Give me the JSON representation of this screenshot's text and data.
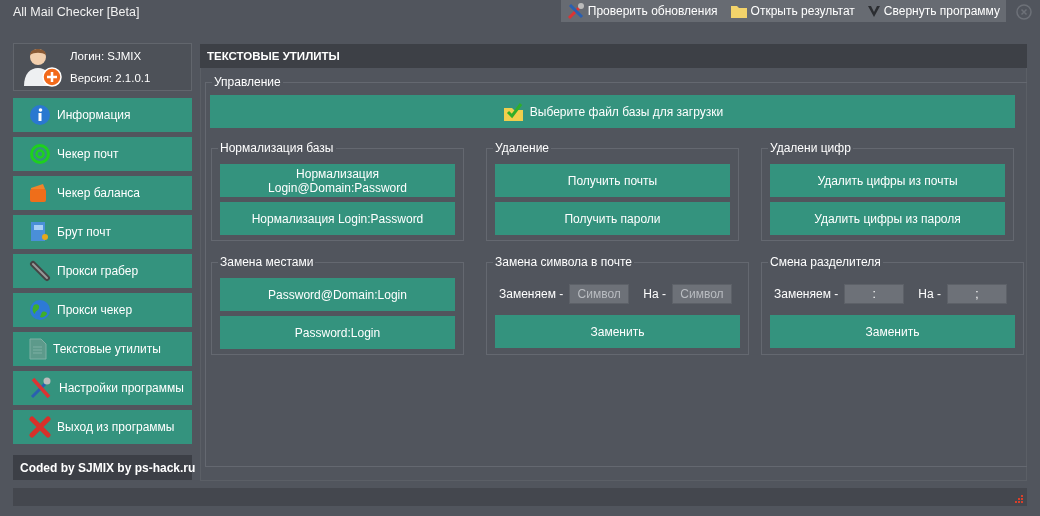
{
  "window": {
    "title": "All Mail Checker [Beta]"
  },
  "toolbar": [
    {
      "label": "Проверить обновления"
    },
    {
      "label": "Открыть результат"
    },
    {
      "label": "Свернуть программу"
    }
  ],
  "profile": {
    "login": "Логин: SJMIX",
    "version": "Версия: 2.1.0.1"
  },
  "sidebar": {
    "items": [
      {
        "label": "Информация"
      },
      {
        "label": "Чекер почт"
      },
      {
        "label": "Чекер баланса"
      },
      {
        "label": "Брут почт"
      },
      {
        "label": "Прокси грабер"
      },
      {
        "label": "Прокси чекер"
      },
      {
        "label": "Текстовые утилиты"
      },
      {
        "label": "Настройки программы"
      },
      {
        "label": "Выход из программы"
      }
    ],
    "credit": "Coded by SJMIX by ps-hack.ru"
  },
  "panel": {
    "title": "ТЕКСТОВЫЕ УТИЛИТЫ",
    "group_title": "Управление",
    "load_button": "Выберите файл базы для загрузки",
    "groups": [
      {
        "title": "Нормализация базы",
        "rows": [
          {
            "kind": "button",
            "label": "Нормализация Login@Domain:Password"
          },
          {
            "kind": "button",
            "label": "Нормализация Login:Password"
          }
        ]
      },
      {
        "title": "Удаление",
        "rows": [
          {
            "kind": "button",
            "label": "Получить почты"
          },
          {
            "kind": "button",
            "label": "Получить пароли"
          }
        ]
      },
      {
        "title": "Удалени цифр",
        "rows": [
          {
            "kind": "button",
            "label": "Удалить цифры из почты"
          },
          {
            "kind": "button",
            "label": "Удалить цифры из пароля"
          }
        ]
      },
      {
        "title": "Замена местами",
        "rows": [
          {
            "kind": "button",
            "label": "Password@Domain:Login"
          },
          {
            "kind": "button",
            "label": "Password:Login"
          }
        ]
      },
      {
        "title": "Замена символа в почте",
        "rows": [
          {
            "kind": "fields",
            "fields": [
              {
                "label": "Заменяем -",
                "placeholder": "Символ"
              },
              {
                "label": "На -",
                "placeholder": "Символ"
              }
            ]
          },
          {
            "kind": "button",
            "label": "Заменить"
          }
        ]
      },
      {
        "title": "Смена разделителя",
        "rows": [
          {
            "kind": "fields",
            "fields": [
              {
                "label": "Заменяем -",
                "value": ":"
              },
              {
                "label": "На -",
                "value": ";"
              }
            ]
          },
          {
            "kind": "button",
            "label": "Заменить"
          }
        ]
      }
    ]
  }
}
